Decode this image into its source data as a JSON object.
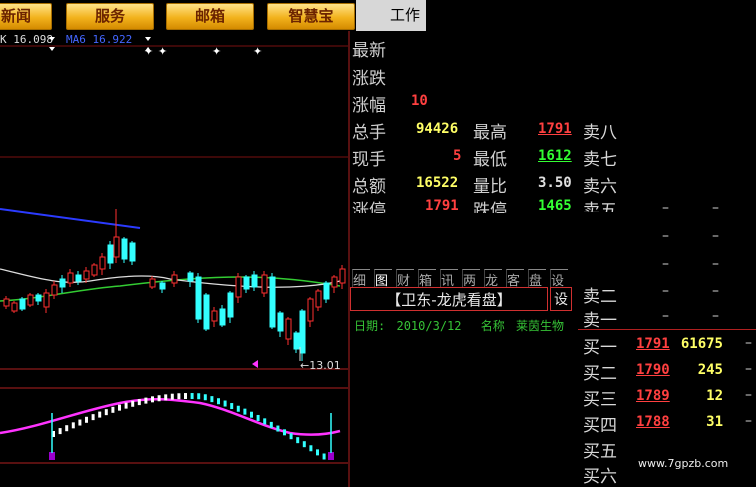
{
  "nav": {
    "items": [
      "新闻",
      "服务",
      "邮箱",
      "智慧宝"
    ],
    "workarea": "工作区"
  },
  "chart": {
    "ma_label1": "K 16.098",
    "ma_label2": "MA6  16.922",
    "low_marker": "←13.01",
    "colors": {
      "up": "#ff3030",
      "down": "#33ffff",
      "ma_long": "#2b3bff",
      "ma_mid": "#33cc33",
      "ma_short": "#dddddd",
      "macd": "#ff33ff"
    }
  },
  "quote": {
    "left_labels": [
      "最新",
      "涨跌",
      "涨幅",
      "总手",
      "现手",
      "总额",
      "涨停"
    ],
    "left_values": [
      "",
      "",
      "10",
      "94426",
      "5",
      "16522",
      "1791"
    ],
    "mid_labels": [
      "最高",
      "最低",
      "量比",
      "跌停"
    ],
    "mid_values": [
      "1791",
      "1612",
      "3.50",
      "1465"
    ]
  },
  "tabs": [
    "细",
    "图",
    "财",
    "箱",
    "讯",
    "两",
    "龙",
    "客",
    "盘",
    "设"
  ],
  "panel": {
    "title": "【卫东-龙虎看盘】",
    "settings": "设",
    "date_label": "日期:",
    "date": "2010/3/12",
    "name_label": "名称",
    "name": "莱茵生物"
  },
  "orderbook": {
    "sell_labels": [
      "卖八",
      "卖七",
      "卖六",
      "卖五",
      "",
      "",
      "卖二",
      "卖一"
    ],
    "buy": [
      {
        "label": "买一",
        "price": "1791",
        "vol": "61675"
      },
      {
        "label": "买二",
        "price": "1790",
        "vol": "245"
      },
      {
        "label": "买三",
        "price": "1789",
        "vol": "12"
      },
      {
        "label": "买四",
        "price": "1788",
        "vol": "31"
      },
      {
        "label": "买五",
        "price": "",
        "vol": ""
      },
      {
        "label": "买六",
        "price": "",
        "vol": ""
      }
    ],
    "dash": "–"
  },
  "watermark": "www.7gpzb.com"
}
